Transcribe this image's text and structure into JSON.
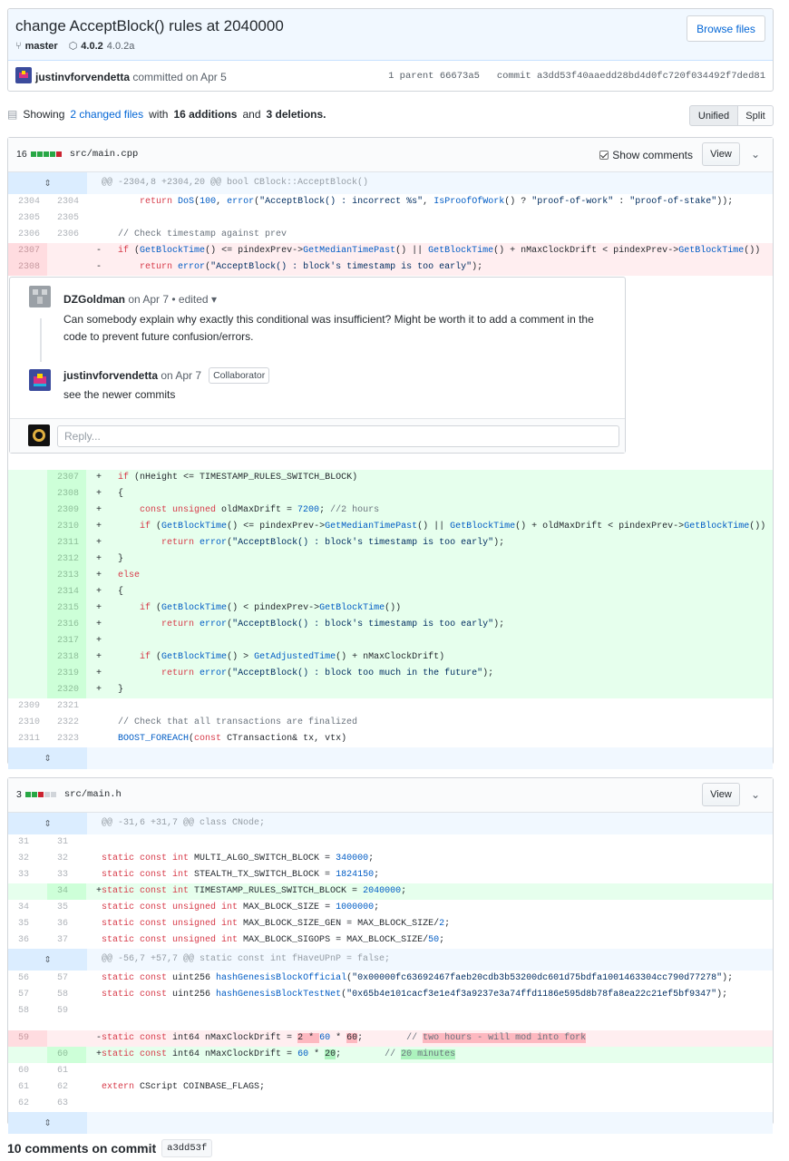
{
  "commit": {
    "title": "change AcceptBlock() rules at 2040000",
    "branch": "master",
    "tags": [
      "4.0.2",
      "4.0.2a"
    ],
    "browse_label": "Browse files",
    "author": "justinvforvendetta",
    "committed": "committed on Apr 5",
    "parent_label": "1 parent",
    "parent_sha": "66673a5",
    "commit_label": "commit",
    "commit_sha": "a3dd53f40aaedd28bd4d0fc720f034492f7ded81"
  },
  "summary": {
    "prefix": "Showing",
    "changed": "2 changed files",
    "with": "with",
    "additions": "16 additions",
    "and": "and",
    "deletions": "3 deletions."
  },
  "view_toggle": {
    "unified": "Unified",
    "split": "Split"
  },
  "files": [
    {
      "count": "16",
      "name": "src/main.cpp",
      "show_comments": "Show comments",
      "view": "View"
    },
    {
      "count": "3",
      "name": "src/main.h",
      "view": "View"
    }
  ],
  "file1_hunk": "@@ -2304,8 +2304,20 @@ bool CBlock::AcceptBlock()",
  "file2_hunks": [
    "@@ -31,6 +31,7 @@ class CNode;",
    "@@ -56,7 +57,7 @@ static const int fHaveUPnP = false;"
  ],
  "comments": [
    {
      "author": "DZGoldman",
      "meta": "on Apr 7 • edited ▾",
      "body": "Can somebody explain why exactly this conditional was insufficient? Might be worth it to add a comment in the code to prevent future confusion/errors."
    },
    {
      "author": "justinvforvendetta",
      "meta": "on Apr 7",
      "badge": "Collaborator",
      "body": "see the newer commits"
    }
  ],
  "reply_placeholder": "Reply...",
  "footer": {
    "text": "10 comments on commit",
    "sha": "a3dd53f"
  },
  "colors": {
    "add": "#e6ffed",
    "del": "#ffeef0",
    "hunk": "#f1f8ff",
    "link": "#0366d6"
  }
}
